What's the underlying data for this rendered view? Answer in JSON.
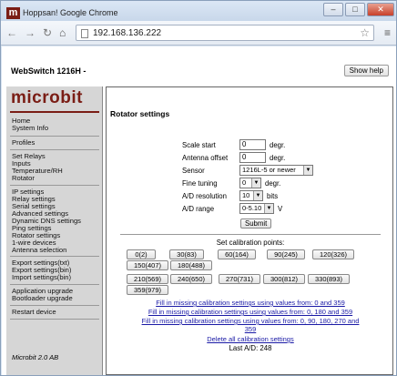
{
  "browser": {
    "tab_title": "Hoppsan! Google Chrome",
    "favicon_letter": "m",
    "url": "192.168.136.222",
    "back_icon": "back-arrow-icon",
    "forward_icon": "forward-arrow-icon",
    "reload_icon": "reload-icon",
    "home_icon": "home-icon"
  },
  "header": {
    "title": "WebSwitch 1216H -",
    "show_help": "Show help"
  },
  "sidebar": {
    "brand": "microbit",
    "group1": [
      "Home",
      "System Info"
    ],
    "group2": [
      "Profiles"
    ],
    "group3": [
      "Set Relays",
      "Inputs",
      "Temperature/RH",
      "Rotator"
    ],
    "group4": [
      "IP settings",
      "Relay settings",
      "Serial settings",
      "Advanced settings",
      "Dynamic DNS settings",
      "Ping settings",
      "Rotator settings",
      "1-wire devices",
      "Antenna selection"
    ],
    "group5": [
      "Export settings(txt)",
      "Export settings(bin)",
      "Import settings(bin)"
    ],
    "group6": [
      "Application upgrade",
      "Bootloader upgrade"
    ],
    "group7": [
      "Restart device"
    ],
    "footer": "Microbit 2.0 AB"
  },
  "main": {
    "title": "Rotator settings",
    "form": {
      "scale_start_label": "Scale start",
      "scale_start_value": "0",
      "scale_start_unit": "degr.",
      "antenna_offset_label": "Antenna offset",
      "antenna_offset_value": "0",
      "antenna_offset_unit": "degr.",
      "sensor_label": "Sensor",
      "sensor_value": "1216L-5 or newer",
      "fine_tuning_label": "Fine tuning",
      "fine_tuning_value": "0",
      "fine_tuning_unit": "degr.",
      "ad_resolution_label": "A/D resolution",
      "ad_resolution_value": "10",
      "ad_resolution_unit": "bits",
      "ad_range_label": "A/D range",
      "ad_range_value": "0-5.10",
      "ad_range_unit": "V",
      "submit": "Submit"
    },
    "set_calibration_label": "Set calibration points:",
    "calibration_points": [
      "0(2)",
      "30(83)",
      "60(164)",
      "90(245)",
      "120(326)",
      "150(407)",
      "180(488)",
      "210(569)",
      "240(650)",
      "270(731)",
      "300(812)",
      "330(893)",
      "359(979)"
    ],
    "links": [
      "Fill in missing calibration settings using values from: 0 and 359",
      "Fill in missing calibration settings using values from: 0, 180 and 359",
      "Fill in missing calibration settings using values from: 0, 90, 180, 270 and 359",
      "Delete all calibration settings"
    ],
    "last_ad": "Last A/D: 248"
  }
}
